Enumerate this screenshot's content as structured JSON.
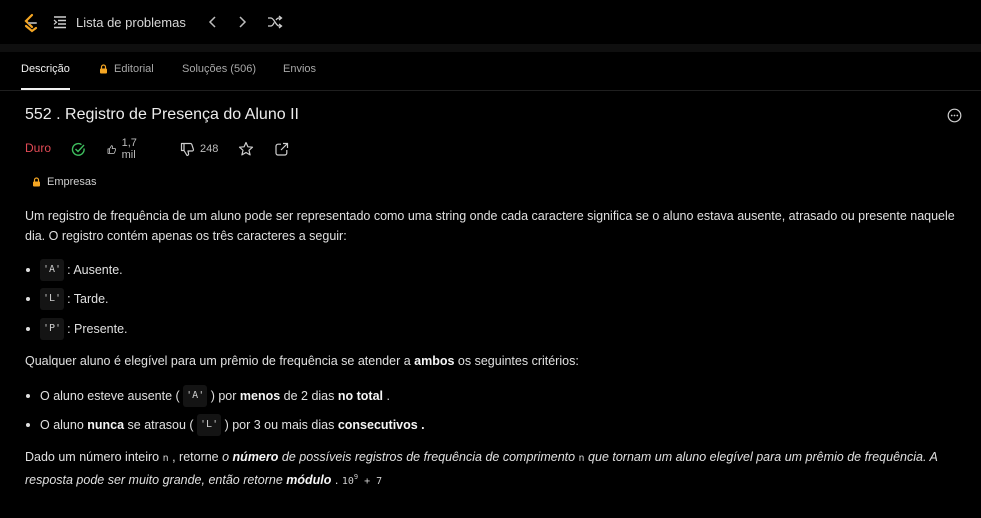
{
  "topbar": {
    "list_label": "Lista de problemas"
  },
  "tabs": [
    {
      "label": "Descrição"
    },
    {
      "label": "Editorial"
    },
    {
      "label": "Soluções (506)"
    },
    {
      "label": "Envios"
    }
  ],
  "problem": {
    "title": "552 . Registro de Presença do Aluno II",
    "difficulty": "Duro",
    "likes": "1,7 mil",
    "dislikes": "248",
    "tag": "Empresas"
  },
  "content": {
    "intro_1": "Um registro de frequência de um aluno pode ser representado como uma string onde cada caractere significa se o aluno estava ausente, atrasado ou presente naquele",
    "intro_2": "dia. O registro contém apenas os três caracteres a seguir:",
    "chars": [
      {
        "code": "'A'",
        "text": ": Ausente."
      },
      {
        "code": "'L'",
        "text": ": Tarde."
      },
      {
        "code": "'P'",
        "text": ": Presente."
      }
    ],
    "criteria_intro_a": "Qualquer aluno é elegível para um prêmio de frequência se atender a ",
    "criteria_intro_b": "ambos",
    "criteria_intro_c": " os seguintes critérios:",
    "crit1": {
      "a": "O aluno esteve ausente ( ",
      "code": "'A'",
      "b": " ) por ",
      "bold1": "menos",
      "c": " de 2 dias ",
      "bold2": "no total",
      "d": " ."
    },
    "crit2": {
      "a": "O aluno ",
      "bold1": "nunca",
      "b": " se atrasou ( ",
      "code": "'L'",
      "c": " ) por 3 ou mais dias ",
      "bold2": "consecutivos ."
    },
    "final": {
      "a": "Dado um número inteiro ",
      "n1": "n",
      "b": " , retorne ",
      "c": "o ",
      "bold1": "número",
      "d": " de possíveis registros de frequência de comprimento ",
      "n2": "n",
      "e": " que tornam um aluno elegível para um prêmio de frequência. A",
      "f": "resposta pode ser muito grande, então retorne ",
      "bold2": "módulo",
      "g": " . ",
      "mod_base": "10",
      "mod_exp": "9",
      "mod_tail": " + 7"
    }
  },
  "colors": {
    "background": "#000000",
    "difficulty": "#e24a55",
    "accent_lock": "#f5a623",
    "logo": "#f5a623"
  }
}
